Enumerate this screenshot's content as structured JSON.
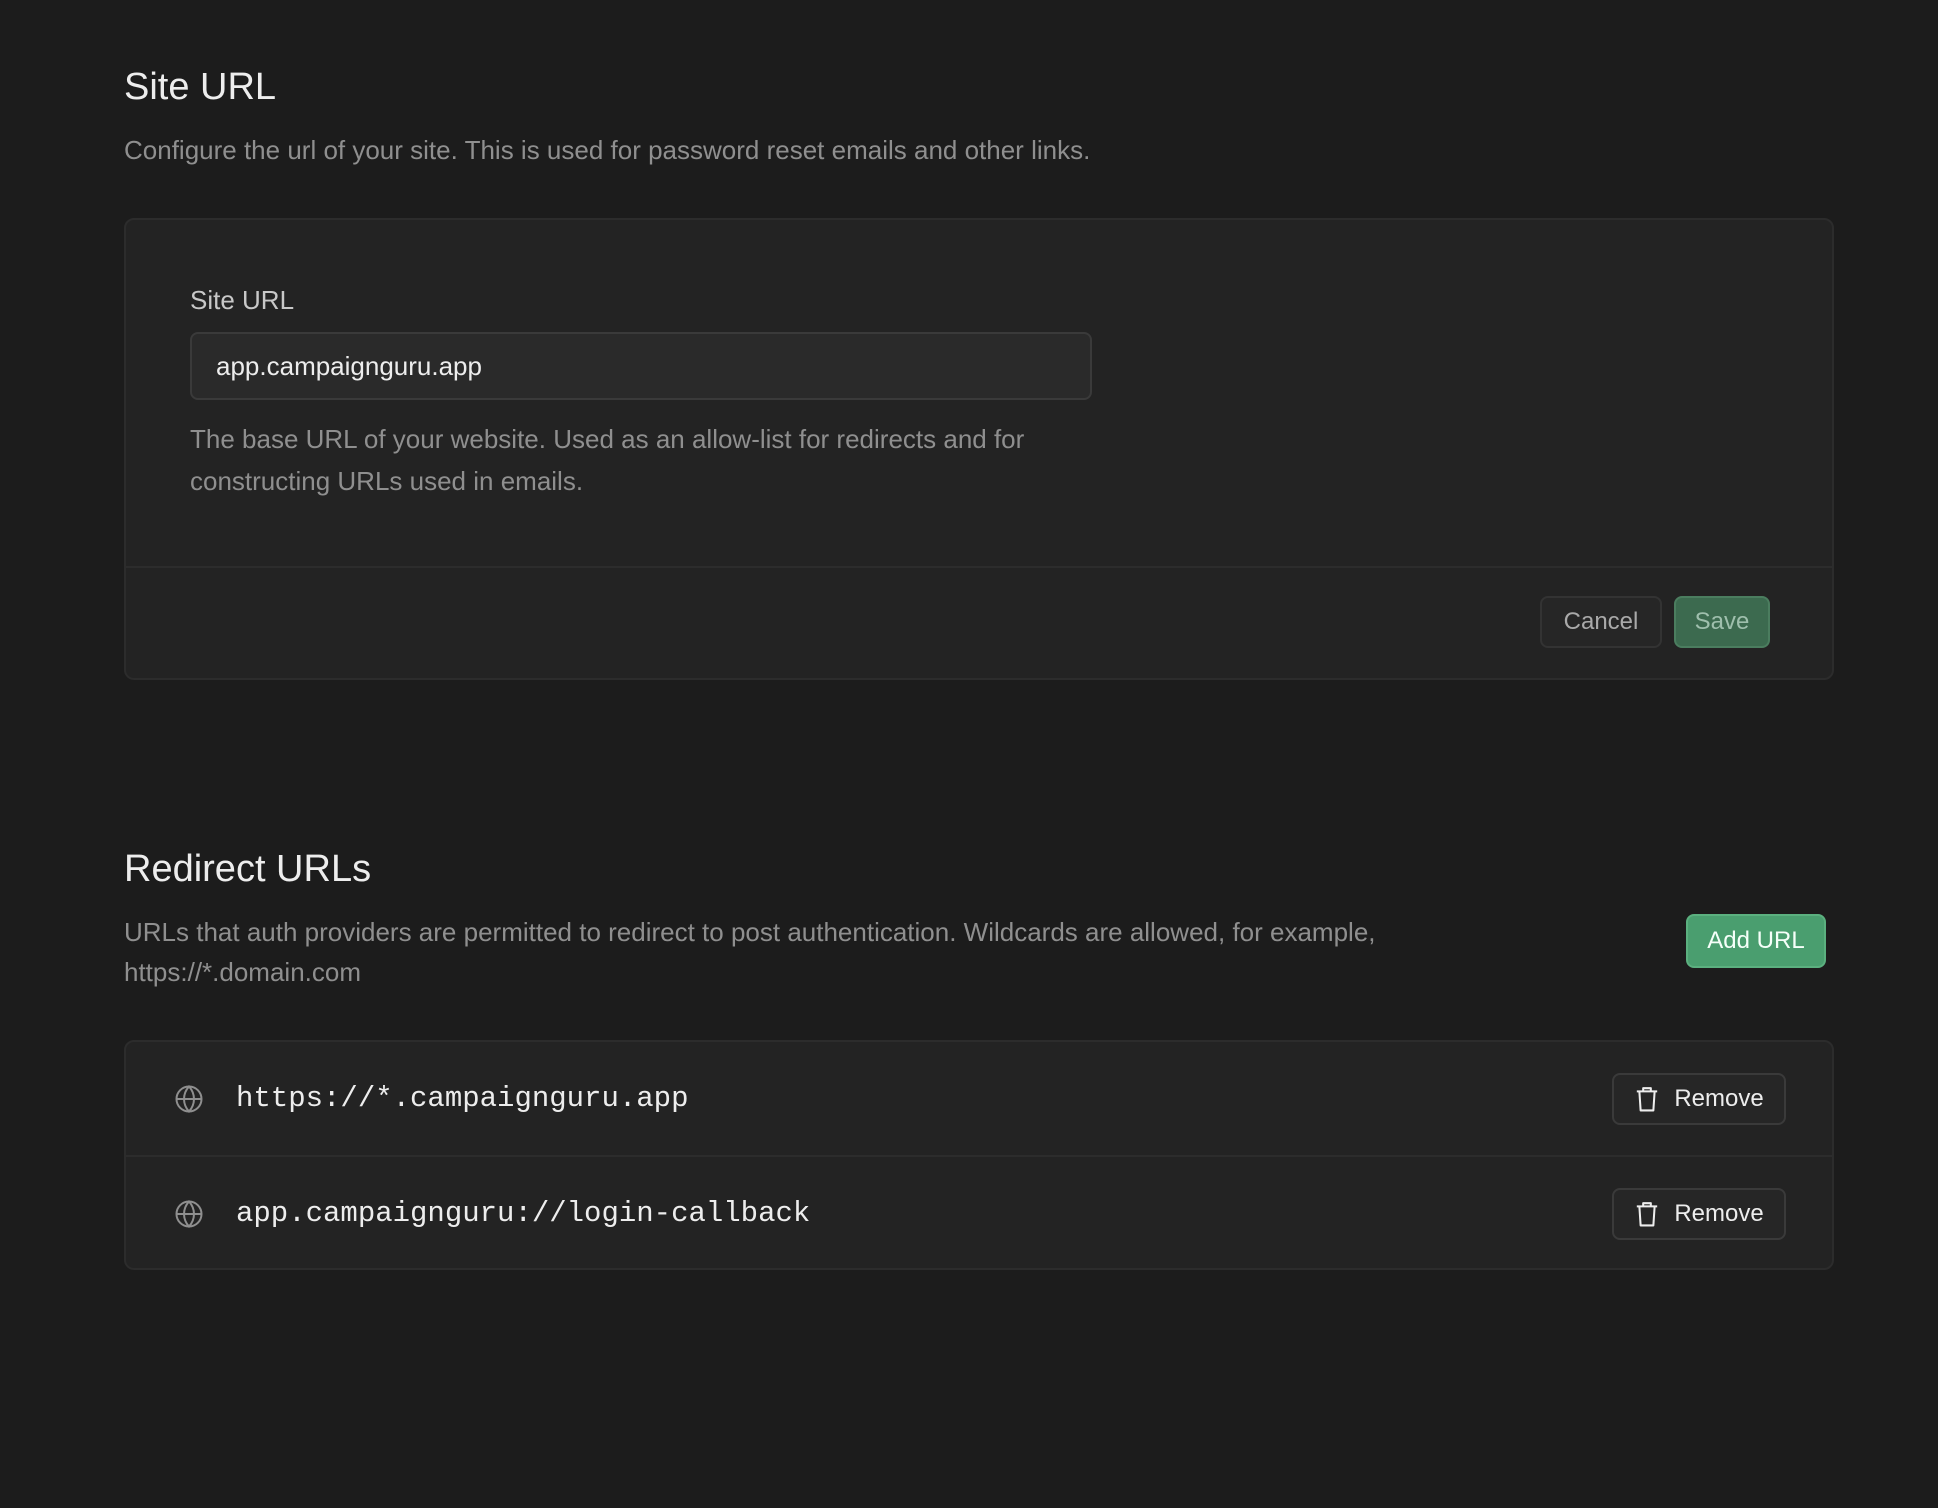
{
  "site_url": {
    "title": "Site URL",
    "description": "Configure the url of your site. This is used for password reset emails and other links.",
    "field_label": "Site URL",
    "field_value": "app.campaignguru.app",
    "field_help": "The base URL of your website. Used as an allow-list for redirects and for constructing URLs used in emails.",
    "cancel_label": "Cancel",
    "save_label": "Save"
  },
  "redirect_urls": {
    "title": "Redirect URLs",
    "description": "URLs that auth providers are permitted to redirect to post authentication. Wildcards are allowed, for example, https://*.domain.com",
    "add_label": "Add URL",
    "items": [
      {
        "url": "https://*.campaignguru.app",
        "icon": "globe-icon",
        "remove_label": "Remove",
        "remove_icon": "trash-icon"
      },
      {
        "url": "app.campaignguru://login-callback",
        "icon": "globe-icon",
        "remove_label": "Remove",
        "remove_icon": "trash-icon"
      }
    ]
  },
  "colors": {
    "background": "#1c1c1c",
    "card": "#232323",
    "accent": "#4a9e6f",
    "muted_text": "#8f8f8f"
  }
}
